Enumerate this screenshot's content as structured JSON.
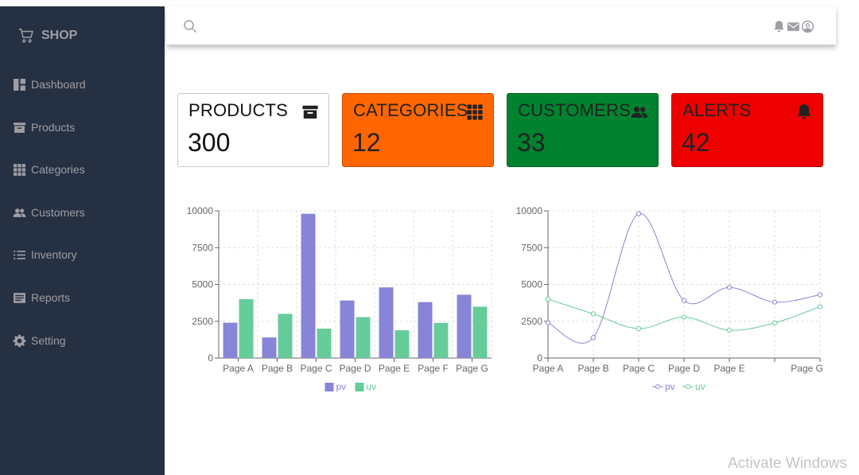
{
  "brand": {
    "name": "SHOP"
  },
  "sidebar": {
    "items": [
      {
        "label": "Dashboard",
        "icon": "dashboard-icon"
      },
      {
        "label": "Products",
        "icon": "archive-icon"
      },
      {
        "label": "Categories",
        "icon": "grid-icon"
      },
      {
        "label": "Customers",
        "icon": "people-icon"
      },
      {
        "label": "Inventory",
        "icon": "list-icon"
      },
      {
        "label": "Reports",
        "icon": "report-icon"
      },
      {
        "label": "Setting",
        "icon": "gear-icon"
      }
    ]
  },
  "header": {
    "icons": [
      "search-icon",
      "bell-icon",
      "envelope-icon",
      "user-circle-icon"
    ]
  },
  "cards": [
    {
      "title": "PRODUCTS",
      "value": "300",
      "icon": "archive-icon",
      "color": "#ffffff"
    },
    {
      "title": "CATEGORIES",
      "value": "12",
      "icon": "grid-icon",
      "color": "#ff6600"
    },
    {
      "title": "CUSTOMERS",
      "value": "33",
      "icon": "people-icon",
      "color": "#00822f"
    },
    {
      "title": "ALERTS",
      "value": "42",
      "icon": "bell-icon",
      "color": "#ee0000"
    }
  ],
  "watermark": "Activate Windows",
  "chart_data": [
    {
      "type": "bar",
      "categories": [
        "Page A",
        "Page B",
        "Page C",
        "Page D",
        "Page E",
        "Page F",
        "Page G"
      ],
      "series": [
        {
          "name": "pv",
          "values": [
            2400,
            1398,
            9800,
            3908,
            4800,
            3800,
            4300
          ],
          "color": "#8884d8"
        },
        {
          "name": "uv",
          "values": [
            4000,
            3000,
            2000,
            2780,
            1890,
            2390,
            3490
          ],
          "color": "#66cc99"
        }
      ],
      "yticks": [
        "0",
        "2500",
        "5000",
        "7500",
        "10000"
      ],
      "ylim": [
        0,
        10000
      ],
      "grid": true,
      "legend": "bottom"
    },
    {
      "type": "line",
      "categories": [
        "Page A",
        "Page B",
        "Page C",
        "Page D",
        "Page E",
        "Page F",
        "Page G"
      ],
      "xticks_shown": [
        "Page A",
        "Page B",
        "Page C",
        "Page D",
        "Page E",
        "",
        "Page G"
      ],
      "series": [
        {
          "name": "pv",
          "values": [
            2400,
            1398,
            9800,
            3908,
            4800,
            3800,
            4300
          ],
          "color": "#8884d8"
        },
        {
          "name": "uv",
          "values": [
            4000,
            3000,
            2000,
            2780,
            1890,
            2390,
            3490
          ],
          "color": "#66cc99"
        }
      ],
      "yticks": [
        "0",
        "2500",
        "5000",
        "7500",
        "10000"
      ],
      "ylim": [
        0,
        10000
      ],
      "grid": true,
      "legend": "bottom"
    }
  ]
}
